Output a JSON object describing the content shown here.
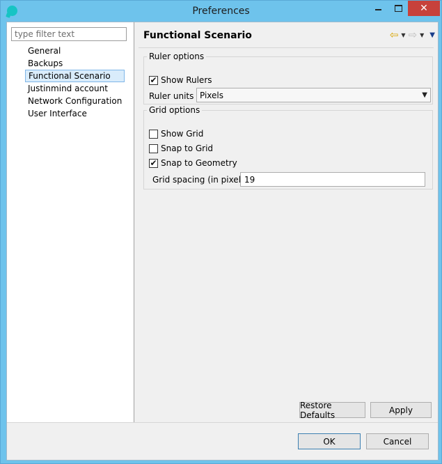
{
  "window": {
    "title": "Preferences",
    "close_glyph": "✕"
  },
  "filter": {
    "placeholder": "type filter text",
    "value": ""
  },
  "nav": {
    "items": [
      {
        "label": "General"
      },
      {
        "label": "Backups"
      },
      {
        "label": "Functional Scenario",
        "selected": true
      },
      {
        "label": "Justinmind account"
      },
      {
        "label": "Network Configuration"
      },
      {
        "label": "User Interface"
      }
    ]
  },
  "page": {
    "title": "Functional Scenario",
    "back_icon": "⇦",
    "forward_icon": "⇨",
    "dropdown_glyph": "▼",
    "menu_glyph": "▼"
  },
  "ruler": {
    "legend": "Ruler options",
    "show_rulers": {
      "label": "Show Rulers",
      "checked": true
    },
    "units_label": "Ruler units",
    "units_value": "Pixels"
  },
  "grid": {
    "legend": "Grid options",
    "show_grid": {
      "label": "Show Grid",
      "checked": false
    },
    "snap_grid": {
      "label": "Snap to Grid",
      "checked": false
    },
    "snap_geometry": {
      "label": "Snap to Geometry",
      "checked": true
    },
    "spacing_label": "Grid spacing (in pixels)",
    "spacing_value": "19"
  },
  "buttons": {
    "restore_defaults": "Restore Defaults",
    "apply": "Apply",
    "ok": "OK",
    "cancel": "Cancel"
  },
  "check_glyph": "✔",
  "colors": {
    "titlebar": "#6ec3ec",
    "close_button": "#c7413b",
    "selection": "#d9ecfb"
  }
}
